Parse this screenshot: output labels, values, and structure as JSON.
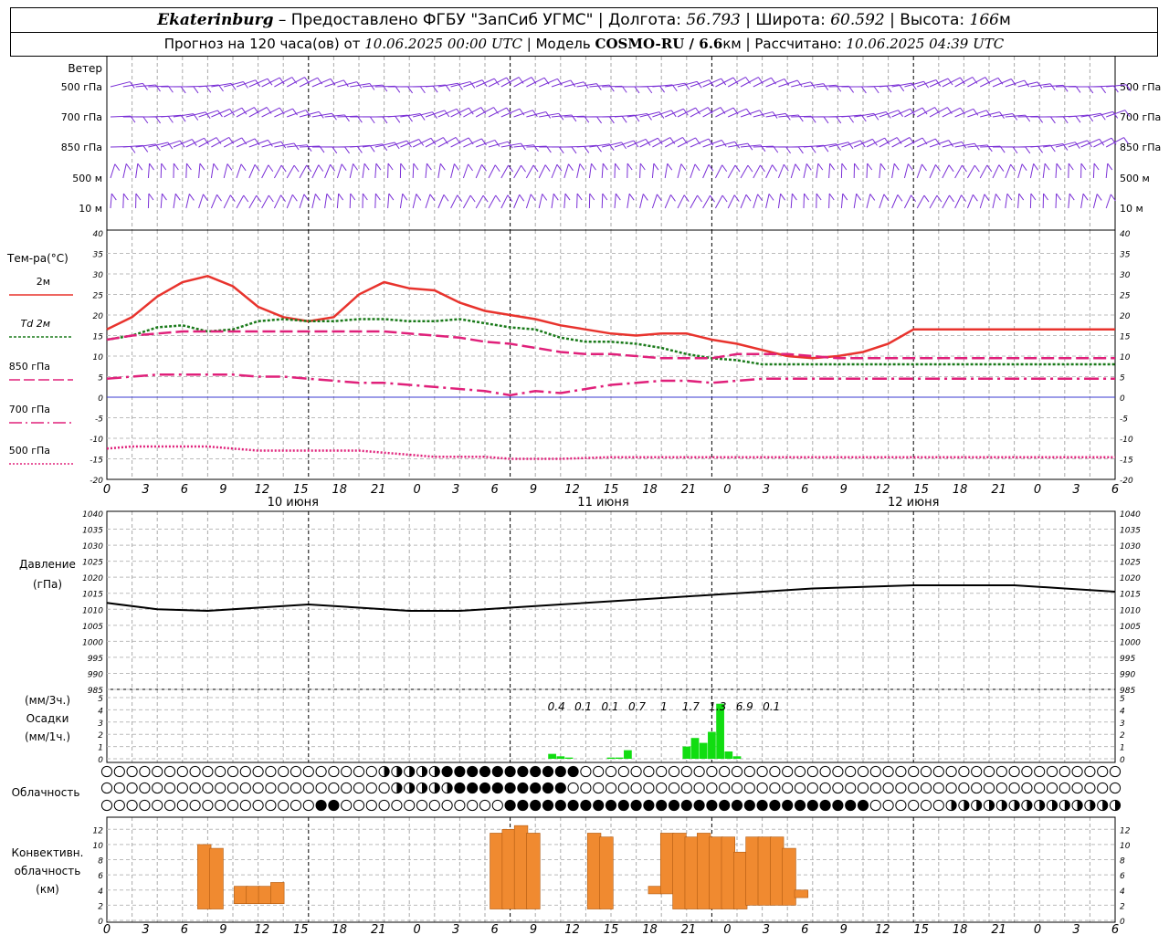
{
  "header": {
    "city": "Ekaterinburg",
    "provided": " – Предоставлено ФГБУ \"ЗапСиб УГМС\" | Долгота: ",
    "lon": "56.793",
    "lat_label": " | Широта: ",
    "lat": "60.592",
    "alt_label": " | Высота: ",
    "alt": "166",
    "alt_unit": "м",
    "forecast_prefix": "Прогноз на 120 часа(ов) от ",
    "forecast_time": "10.06.2025 00:00 UTC",
    "model_label": " | Модель ",
    "model": "COSMO-RU / 6.6",
    "model_unit": "км",
    "calc_label": " | Рассчитано: ",
    "calc_time": "10.06.2025 04:39 UTC"
  },
  "x_ticks": [
    "0",
    "3",
    "6",
    "9",
    "12",
    "15",
    "18",
    "21",
    "0",
    "3",
    "6",
    "9",
    "12",
    "15",
    "18",
    "21",
    "0",
    "3",
    "6",
    "9",
    "12",
    "15",
    "18",
    "21",
    "0",
    "3",
    "6"
  ],
  "day_labels": [
    "10 июня",
    "11 июня",
    "12 июня"
  ],
  "wind": {
    "title": "Ветер",
    "levels": [
      "500 гПа",
      "700 гПа",
      "850 гПа",
      "500 м",
      "10 м"
    ],
    "color": "#7a2fd6"
  },
  "temperature": {
    "title": "Тем-ра(°C)",
    "legend": [
      "2м",
      "Td 2м",
      "850 гПа",
      "700 гПа",
      "500 гПа"
    ],
    "colors": {
      "t2m": "#e8332d",
      "td2m": "#1a7a1a",
      "t850": "#e0207a",
      "t700": "#e0207a",
      "t500": "#e0207a",
      "zero": "#3a3ad0"
    },
    "y_ticks": [
      "40",
      "35",
      "30",
      "25",
      "20",
      "15",
      "10",
      "5",
      "0",
      "-5",
      "-10",
      "-15",
      "-20"
    ]
  },
  "pressure": {
    "title1": "Давление",
    "title2": "(гПа)",
    "y_ticks": [
      "1040",
      "1035",
      "1030",
      "1025",
      "1020",
      "1015",
      "1010",
      "1005",
      "1000",
      "995",
      "990",
      "985"
    ]
  },
  "precip": {
    "title1": "(мм/3ч.)",
    "title2": "Осадки",
    "title3": "(мм/1ч.)",
    "y_ticks": [
      "5",
      "4",
      "3",
      "2",
      "1",
      "0"
    ],
    "labels": [
      "0.4",
      "0.1",
      "0.1",
      "0.7",
      "1",
      "1.7",
      "1.3",
      "6.9",
      "0.1"
    ],
    "color": "#11dd11"
  },
  "clouds": {
    "title": "Облачность"
  },
  "convective": {
    "title1": "Конвективн.",
    "title2": "облачность",
    "title3": "(км)",
    "y_ticks": [
      "12",
      "10",
      "8",
      "6",
      "4",
      "2",
      "0"
    ],
    "color": "#f08a30"
  },
  "chart_data": [
    {
      "type": "line",
      "title": "Тем-ра(°C)",
      "x_hours_since_start": [
        0,
        3,
        6,
        9,
        12,
        15,
        18,
        21,
        24,
        27,
        30,
        33,
        36,
        39,
        42,
        45,
        48,
        51,
        54,
        57,
        60,
        63,
        66,
        69,
        72,
        75,
        78,
        81,
        84,
        87,
        90,
        93,
        96,
        99,
        102,
        105,
        108,
        111,
        114,
        117,
        120
      ],
      "ylim": [
        -20,
        40
      ],
      "series": [
        {
          "name": "2м",
          "values": [
            16.5,
            19.5,
            24.5,
            28,
            29.5,
            27,
            22,
            19.5,
            18.5,
            19.5,
            25,
            28,
            26.5,
            26,
            23,
            21,
            20,
            19,
            17.5,
            16.5,
            15.5,
            15,
            15.5,
            15.5,
            14,
            13,
            11.5,
            10,
            9.5,
            10,
            11,
            13,
            16.5,
            16.5,
            16.5,
            16.5,
            16.5,
            16.5,
            16.5,
            16.5,
            16.5
          ]
        },
        {
          "name": "Td 2м",
          "values": [
            14,
            15,
            17,
            17.5,
            16,
            16.5,
            18.5,
            19,
            18.5,
            18.5,
            19,
            19,
            18.5,
            18.5,
            19,
            18,
            17,
            16.5,
            14.5,
            13.5,
            13.5,
            13,
            12,
            10.5,
            9.5,
            9,
            8,
            8,
            8,
            8,
            8,
            8,
            8,
            8,
            8,
            8,
            8,
            8,
            8,
            8,
            8
          ]
        },
        {
          "name": "850 гПа",
          "values": [
            14,
            15,
            15.5,
            16,
            16,
            16,
            16,
            16,
            16,
            16,
            16,
            16,
            15.5,
            15,
            14.5,
            13.5,
            13,
            12,
            11,
            10.5,
            10.5,
            10,
            9.5,
            9.5,
            9.5,
            10.5,
            10.5,
            10.5,
            10,
            9.5,
            9.5,
            9.5,
            9.5,
            9.5,
            9.5,
            9.5,
            9.5,
            9.5,
            9.5,
            9.5,
            9.5
          ]
        },
        {
          "name": "700 гПа",
          "values": [
            4.5,
            5,
            5.5,
            5.5,
            5.5,
            5.5,
            5,
            5,
            4.5,
            4,
            3.5,
            3.5,
            3,
            2.5,
            2,
            1.5,
            0.5,
            1.5,
            1,
            2,
            3,
            3.5,
            4,
            4,
            3.5,
            4,
            4.5,
            4.5,
            4.5,
            4.5,
            4.5,
            4.5,
            4.5,
            4.5,
            4.5,
            4.5,
            4.5,
            4.5,
            4.5,
            4.5,
            4.5
          ]
        },
        {
          "name": "500 гПа",
          "values": [
            -12.5,
            -12,
            -12,
            -12,
            -12,
            -12.5,
            -13,
            -13,
            -13,
            -13,
            -13,
            -13.5,
            -14,
            -14.5,
            -14.5,
            -14.5,
            -15,
            -15,
            -15,
            -14.8,
            -14.6,
            -14.6,
            -14.6,
            -14.6,
            -14.6,
            -14.6,
            -14.6,
            -14.6,
            -14.6,
            -14.6,
            -14.6,
            -14.6,
            -14.6,
            -14.6,
            -14.6,
            -14.6,
            -14.6,
            -14.6,
            -14.6,
            -14.6,
            -14.6
          ]
        }
      ]
    },
    {
      "type": "line",
      "title": "Давление",
      "x_hours_since_start": [
        0,
        6,
        12,
        18,
        24,
        30,
        36,
        42,
        48,
        54,
        60,
        66,
        72,
        78,
        84,
        90,
        96,
        102,
        108,
        114,
        120
      ],
      "ylim": [
        985,
        1040
      ],
      "series": [
        {
          "name": "Давление",
          "values": [
            1012,
            1010,
            1009.5,
            1010.5,
            1011.5,
            1010.5,
            1009.5,
            1009.5,
            1010.5,
            1011.5,
            1012.5,
            1013.5,
            1014.5,
            1015.5,
            1016.5,
            1017,
            1017.5,
            1017.5,
            1017.5,
            1016.5,
            1015.5
          ]
        }
      ]
    },
    {
      "type": "bar",
      "title": "Осадки",
      "x_hours_since_start": [
        53,
        54,
        55,
        60,
        61,
        62,
        69,
        70,
        71,
        72,
        73,
        74,
        75
      ],
      "ylim": [
        0,
        5
      ],
      "series": [
        {
          "name": "мм/1ч.",
          "values": [
            0.4,
            0.2,
            0.1,
            0.1,
            0.1,
            0.7,
            1,
            1.7,
            1.3,
            2.2,
            4.5,
            0.6,
            0.2
          ]
        }
      ],
      "annotations": [
        "0.4",
        "0.1",
        "0.1",
        "0.7",
        "1",
        "1.7",
        "1.3",
        "6.9",
        "0.1"
      ]
    },
    {
      "type": "bar",
      "title": "Конвективн. облачность (км)",
      "x_hours_since_start": [
        8,
        9,
        11,
        12,
        13,
        14,
        32,
        33,
        34,
        35,
        36,
        40,
        41,
        45,
        46,
        47,
        48,
        49,
        50,
        51,
        52,
        53,
        54,
        55,
        56,
        57
      ],
      "ylim": [
        0,
        13
      ],
      "series": [
        {
          "name": "base",
          "values": [
            1.5,
            1.5,
            2.2,
            2.2,
            2.2,
            2.2,
            1.5,
            1.5,
            1.5,
            1.5,
            1.5,
            1.5,
            1.5,
            3.5,
            3.5,
            1.5,
            1.5,
            1.5,
            1.5,
            1.5,
            1.5,
            2,
            2,
            2,
            2,
            3
          ]
        },
        {
          "name": "top",
          "values": [
            10,
            9.5,
            4.5,
            4.5,
            4.5,
            5,
            11.5,
            12,
            12.5,
            11.5,
            1.5,
            11.5,
            11,
            4.5,
            11.5,
            11.5,
            11,
            11.5,
            11,
            11,
            9,
            11,
            11,
            11,
            9.5,
            4
          ]
        }
      ]
    }
  ]
}
